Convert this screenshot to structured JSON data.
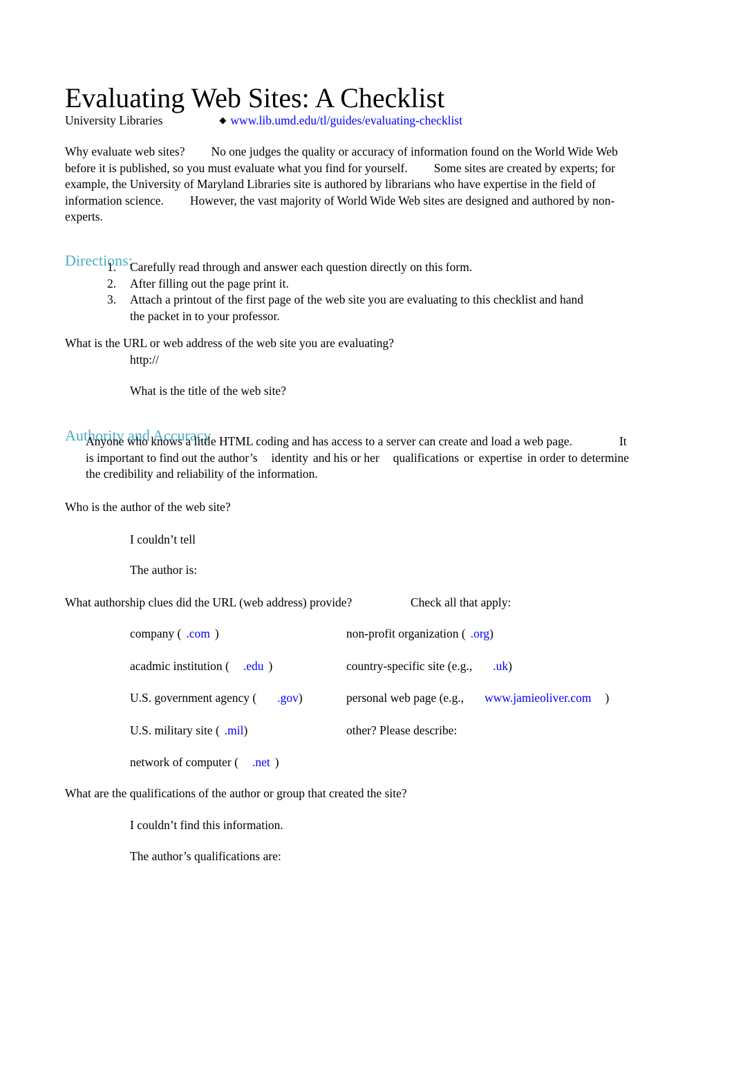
{
  "document": {
    "title": "Evaluating Web Sites: A Checklist",
    "byline": {
      "organization": "University Libraries",
      "bullet_icon": "diamond-bullet",
      "url": "www.lib.umd.edu/tl/guides/evaluating-checklist"
    },
    "intro": {
      "lead": "Why evaluate web sites?",
      "sentence_1": "No one judges the quality or accuracy of information found on the World Wide Web before it is published, so you must evaluate what you find for yourself.",
      "sentence_2": "Some sites are created by experts; for example, the University of Maryland Libraries site is authored by librarians who have expertise in the field of information science.",
      "sentence_3": "However, the vast majority of World Wide Web sites are designed and authored by non-experts."
    },
    "directions": {
      "heading": "Directions:",
      "items": [
        {
          "number": "1.",
          "text": "Carefully read through and answer each question directly on this form."
        },
        {
          "number": "2.",
          "text": "After filling out the page print it."
        },
        {
          "number": "3.",
          "text": "Attach a printout of the first page of the web site you are evaluating to this checklist and hand the packet in to your professor."
        }
      ]
    },
    "url_question": {
      "question": "What is the URL or web address of the web site you are evaluating?",
      "answer_prefix": "http://",
      "title_question": "What is the title of the web site?"
    },
    "authority": {
      "heading": "Authority and Accuracy",
      "paragraph_line_1_a": "Anyone who knows a little HTML coding and has access to a server can create and load a web page.",
      "paragraph_line_1_b": "It",
      "paragraph_line_2_a": "is important to find out the author’s",
      "paragraph_line_2_b": "identity",
      "paragraph_line_2_c": "and his or her",
      "paragraph_line_2_d": "qualifications",
      "paragraph_line_2_e": "or",
      "paragraph_line_2_f": "expertise",
      "paragraph_line_2_g": "in order to determine",
      "paragraph_line_3": "the credibility and reliability of the information.",
      "author_question": "Who is the author of the web site?",
      "author_option_1": "I couldn’t tell",
      "author_option_2": "The author is:",
      "clues_question": "What authorship clues did the URL (web address) provide?",
      "check_all_label": "Check all that apply:"
    },
    "clues": {
      "rows": [
        {
          "left": {
            "label_before": "company (",
            "tld": ".com",
            "label_after": ")"
          },
          "right": {
            "label_before": "non-profit organization (",
            "tld": ".org",
            "label_after": ")"
          }
        },
        {
          "left": {
            "label_before": "acadmic institution (",
            "tld": ".edu",
            "label_after": ")"
          },
          "right": {
            "label_before": "country-specific site (e.g.,",
            "tld": ".uk",
            "label_after": ")"
          }
        },
        {
          "left": {
            "label_before": "U.S. government agency (",
            "tld": ".gov",
            "label_after": ")"
          },
          "right": {
            "label_before": "personal web page (e.g.,",
            "tld": "www.jamieoliver.com",
            "label_after": ")"
          }
        },
        {
          "left": {
            "label_before": "U.S. military site (",
            "tld": ".mil",
            "label_after": ")"
          },
          "right": {
            "label_before": "other?  Please describe:",
            "tld": "",
            "label_after": ""
          }
        },
        {
          "left": {
            "label_before": "network of computer (",
            "tld": ".net",
            "label_after": ")"
          },
          "right": {
            "label_before": "",
            "tld": "",
            "label_after": ""
          }
        }
      ]
    },
    "qualifications": {
      "question": "What are the qualifications of the author or group that created the site?",
      "option_1": "I couldn’t find this information.",
      "option_2": "The author’s qualifications are:"
    },
    "colors": {
      "heading": "#4BACC6",
      "link": "#0000FF",
      "text": "#000000",
      "background": "#FFFFFF"
    }
  }
}
